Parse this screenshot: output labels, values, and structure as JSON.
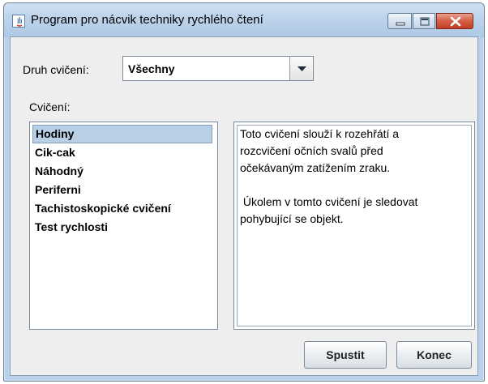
{
  "window": {
    "title": "Program pro nácvik techniky rychlého čtení",
    "controls": [
      "minimize-icon",
      "maximize-icon",
      "close-icon"
    ],
    "colors": {
      "titlebar": "#bdd3ea",
      "close_button": "#c94a30",
      "panel": "#eeeeee",
      "selection": "#b8cfe5"
    }
  },
  "filter": {
    "label": "Druh cvičení:",
    "selected": "Všechny"
  },
  "exercises": {
    "label": "Cvičení:",
    "items": [
      {
        "label": "Hodiny",
        "selected": true
      },
      {
        "label": "Cik-cak",
        "selected": false
      },
      {
        "label": "Náhodný",
        "selected": false
      },
      {
        "label": "Periferni",
        "selected": false
      },
      {
        "label": "Tachistoskopické cvičení",
        "selected": false
      },
      {
        "label": "Test rychlosti",
        "selected": false
      }
    ]
  },
  "description": {
    "lines": [
      "Toto cvičení slouží k rozehřátí a",
      "rozcvičení očních svalů před",
      "očekávaným zatížením zraku.",
      "",
      " Úkolem v tomto cvičení je sledovat",
      "pohybující se objekt."
    ]
  },
  "actions": {
    "run_label": "Spustit",
    "close_label": "Konec"
  }
}
